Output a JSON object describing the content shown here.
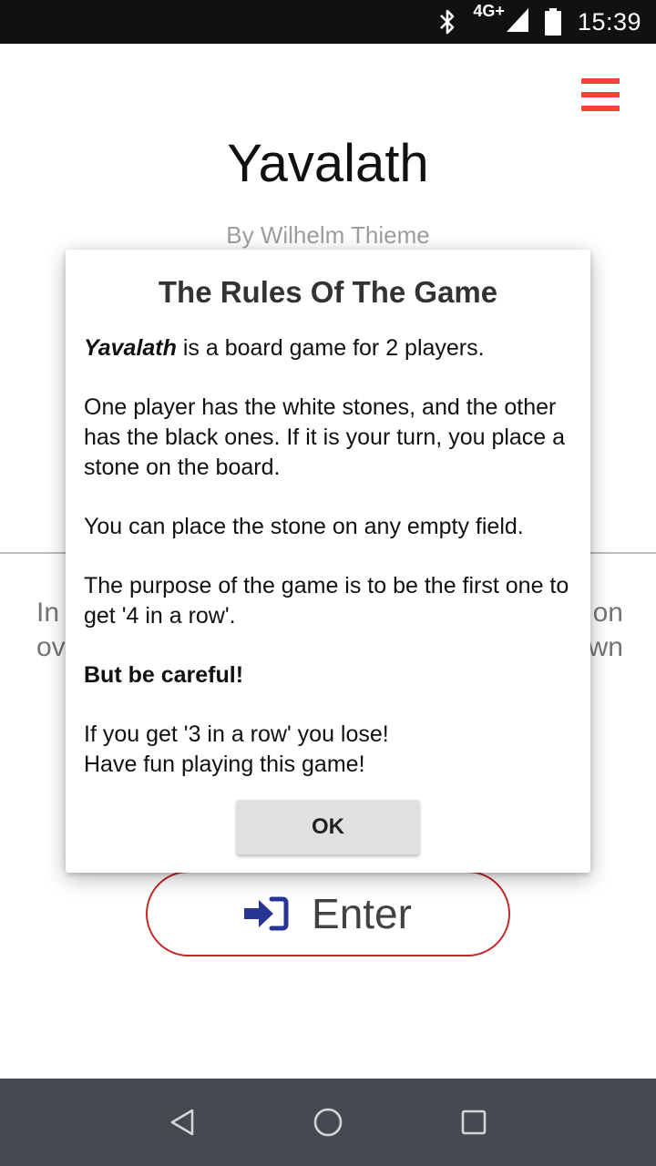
{
  "status_bar": {
    "network_label": "4G+",
    "time": "15:39",
    "icons": [
      "bluetooth-icon",
      "signal-icon",
      "battery-icon"
    ]
  },
  "app": {
    "title": "Yavalath",
    "subtitle": "By Wilhelm Thieme",
    "background_left_lines": [
      "In",
      "ov"
    ],
    "background_right_lines": [
      "on",
      "wn"
    ],
    "enter_button_label": "Enter",
    "accent_color": "#f44336",
    "enter_border_color": "#c62828",
    "enter_icon_color": "#283593"
  },
  "dialog": {
    "title": "The Rules Of The Game",
    "p1_em": "Yavalath",
    "p1_rest": " is a board game for 2 players.",
    "p2": "One player has the white stones, and the other has the black ones. If it is your turn, you place a stone on the board.",
    "p3": "You can place the stone on any empty field.",
    "p4": "The purpose of the game is to be the first one to get '4 in a row'.",
    "p5": "But be careful!",
    "p6_line1": "If you get '3 in a row' you lose!",
    "p6_line2": "Have fun playing this game!",
    "ok_label": "OK"
  },
  "nav_bar": {
    "buttons": [
      "back-icon",
      "home-icon",
      "recents-icon"
    ]
  }
}
